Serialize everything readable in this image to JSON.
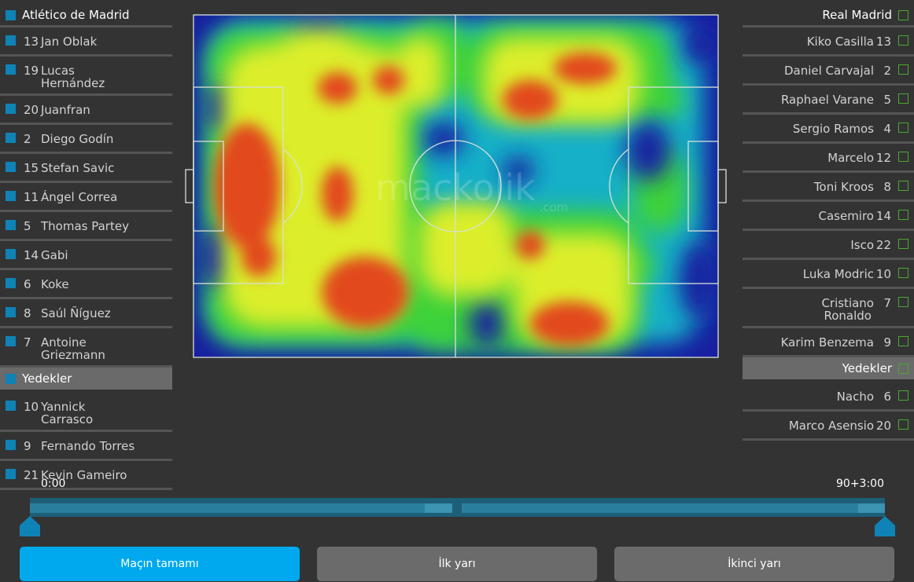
{
  "home": {
    "team": "Atlético de Madrid",
    "players": [
      {
        "number": "13",
        "name": "Jan Oblak"
      },
      {
        "number": "19",
        "name": "Lucas",
        "name2": "Hernández"
      },
      {
        "number": "20",
        "name": "Juanfran"
      },
      {
        "number": "2",
        "name": "Diego Godín"
      },
      {
        "number": "15",
        "name": "Stefan Savic"
      },
      {
        "number": "11",
        "name": "Ángel Correa"
      },
      {
        "number": "5",
        "name": "Thomas Partey"
      },
      {
        "number": "14",
        "name": "Gabi"
      },
      {
        "number": "6",
        "name": "Koke"
      },
      {
        "number": "8",
        "name": "Saúl Ñíguez"
      },
      {
        "number": "7",
        "name": "Antoine",
        "name2": "Griezmann"
      }
    ],
    "subs_label": "Yedekler",
    "subs": [
      {
        "number": "10",
        "name": "Yannick",
        "name2": "Carrasco"
      },
      {
        "number": "9",
        "name": "Fernando Torres"
      },
      {
        "number": "21",
        "name": "Kevin Gameiro"
      }
    ],
    "color": "#0f83b6"
  },
  "away": {
    "team": "Real Madrid",
    "players": [
      {
        "number": "13",
        "name": "Kiko Casilla"
      },
      {
        "number": "2",
        "name": "Daniel Carvajal"
      },
      {
        "number": "5",
        "name": "Raphael Varane"
      },
      {
        "number": "4",
        "name": "Sergio Ramos"
      },
      {
        "number": "12",
        "name": "Marcelo"
      },
      {
        "number": "8",
        "name": "Toni Kroos"
      },
      {
        "number": "14",
        "name": "Casemiro"
      },
      {
        "number": "22",
        "name": "Isco"
      },
      {
        "number": "10",
        "name": "Luka Modric"
      },
      {
        "number": "7",
        "name": "Cristiano",
        "name2": "Ronaldo"
      },
      {
        "number": "9",
        "name": "Karim Benzema"
      }
    ],
    "subs_label": "Yedekler",
    "subs": [
      {
        "number": "6",
        "name": "Nacho"
      },
      {
        "number": "20",
        "name": "Marco Asensio"
      }
    ],
    "color": "#4aa832"
  },
  "heatmap": {
    "watermark": "mackolik",
    "watermark_sub": ".com"
  },
  "timeline": {
    "start": "0:00",
    "end": "90+3:00"
  },
  "buttons": {
    "full": "Maçın tamamı",
    "first": "İlk yarı",
    "second": "İkinci yarı"
  },
  "colors": {
    "accent": "#00a9ee",
    "background": "#333333"
  }
}
